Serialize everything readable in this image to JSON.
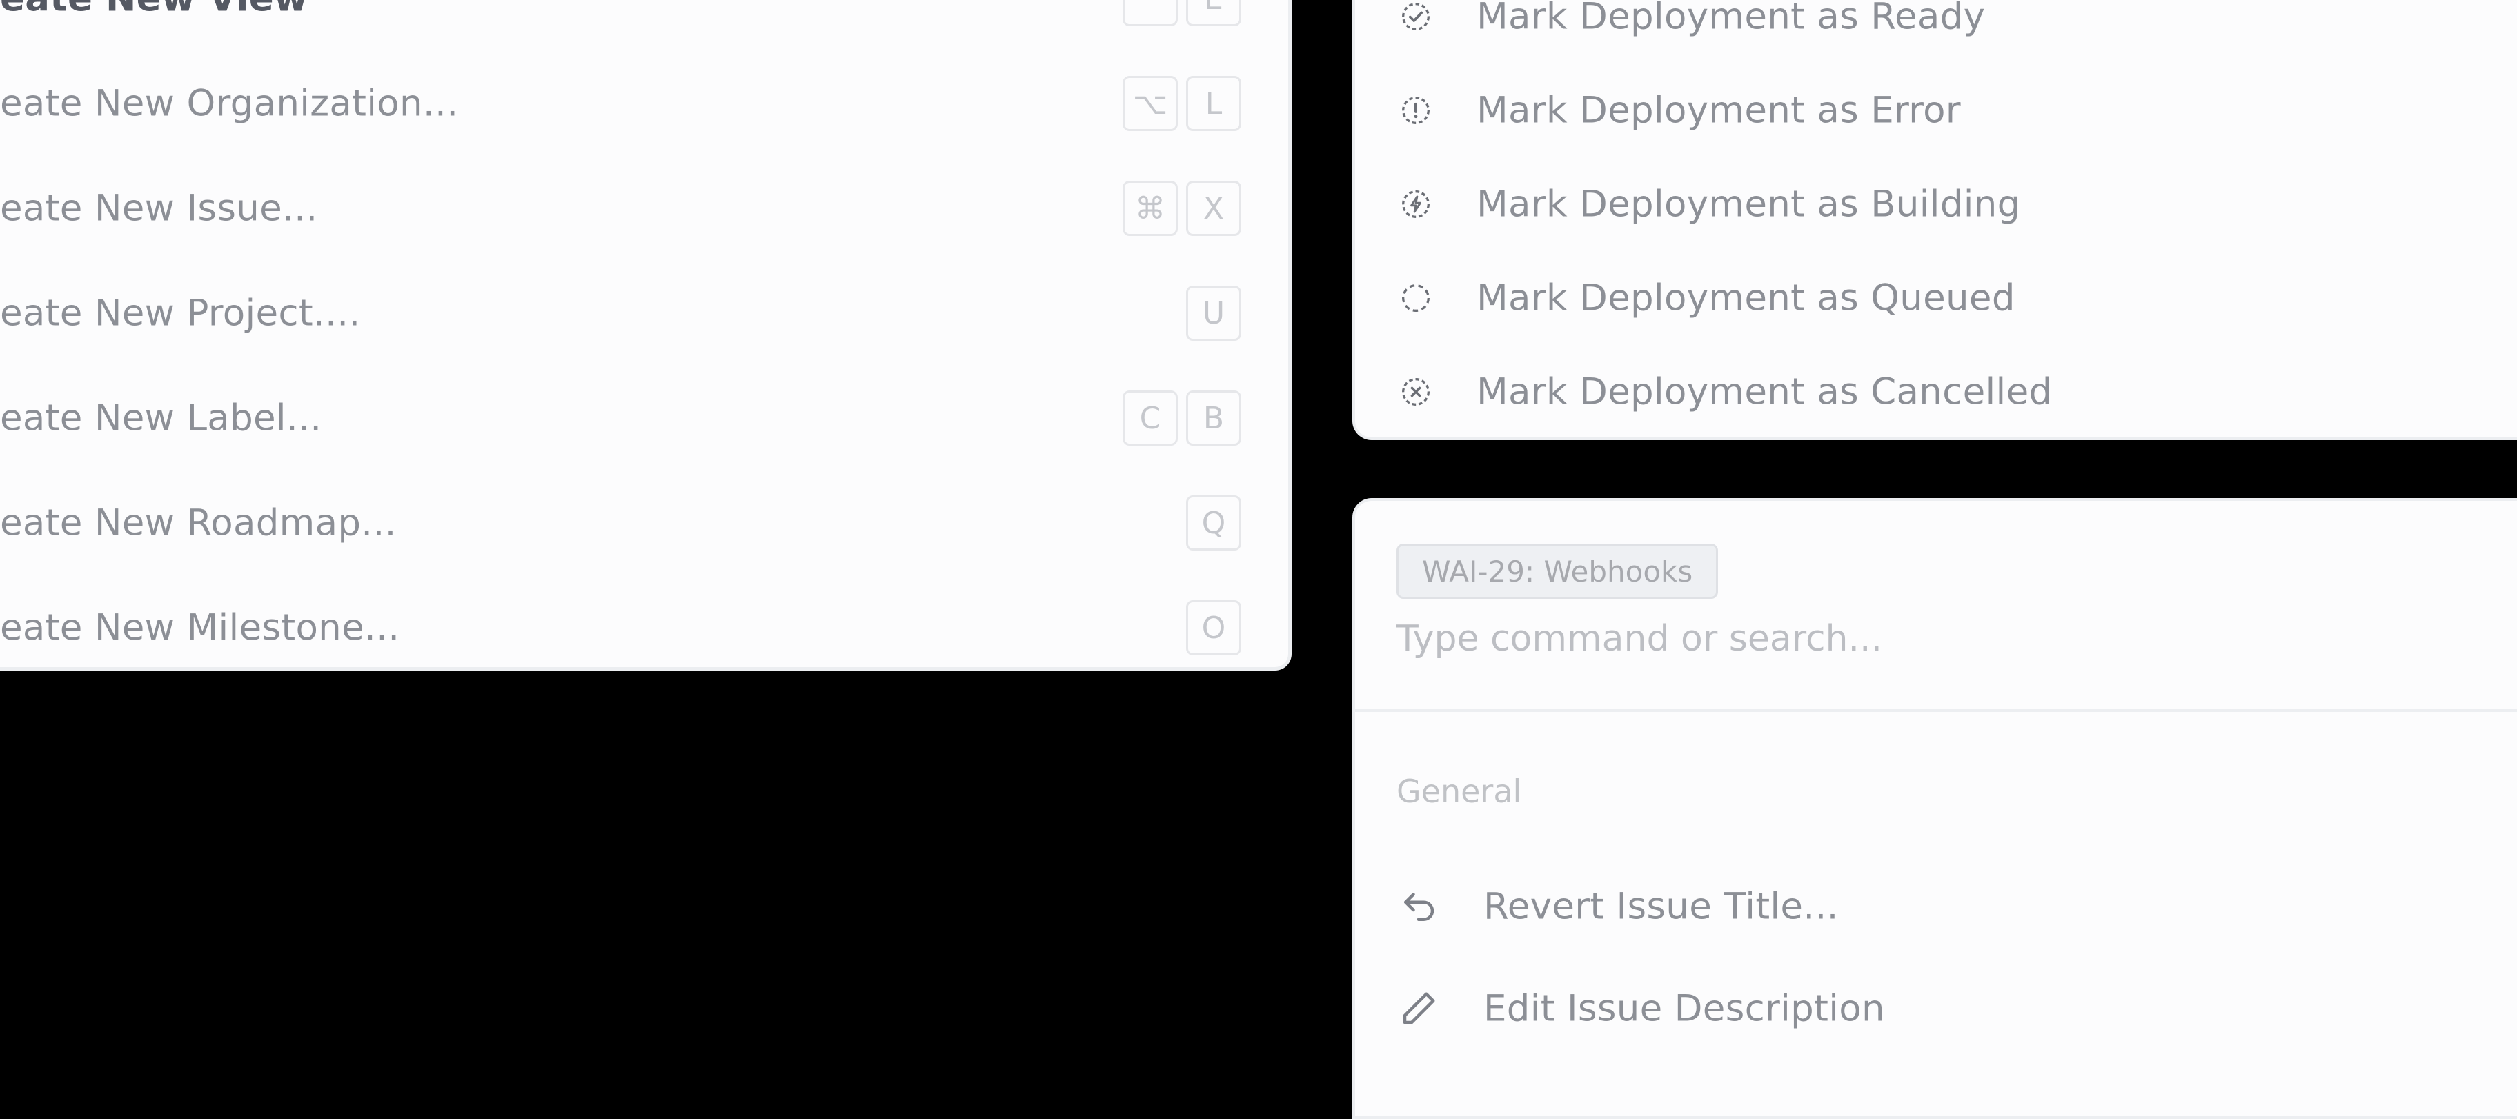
{
  "create_menu": {
    "items": [
      {
        "label": "eate New View",
        "keys": [
          "",
          "E"
        ],
        "highlight": true
      },
      {
        "label": "eate New Organization...",
        "keys": [
          "⌥",
          "L"
        ]
      },
      {
        "label": "eate New Issue...",
        "keys": [
          "⌘",
          "X"
        ]
      },
      {
        "label": "eate New Project....",
        "keys": [
          "U"
        ]
      },
      {
        "label": "eate New Label...",
        "keys": [
          "C",
          "B"
        ]
      },
      {
        "label": "eate New Roadmap...",
        "keys": [
          "Q"
        ]
      },
      {
        "label": "eate New Milestone...",
        "keys": [
          "O"
        ]
      }
    ]
  },
  "deployment_menu": {
    "items": [
      {
        "label": "Mark Deployment as Ready",
        "icon": "check-circle-icon"
      },
      {
        "label": "Mark Deployment as Error",
        "icon": "alert-circle-icon"
      },
      {
        "label": "Mark Deployment as Building",
        "icon": "bolt-circle-icon"
      },
      {
        "label": "Mark Deployment as Queued",
        "icon": "dashed-circle-icon"
      },
      {
        "label": "Mark Deployment as Cancelled",
        "icon": "x-circle-icon"
      }
    ]
  },
  "command_palette": {
    "tag": "WAI-29: Webhooks",
    "search_placeholder": "Type command or search...",
    "section_label": "General",
    "items": [
      {
        "label": "Revert Issue Title...",
        "icon": "undo-icon"
      },
      {
        "label": "Edit Issue Description",
        "icon": "pencil-icon"
      }
    ]
  }
}
